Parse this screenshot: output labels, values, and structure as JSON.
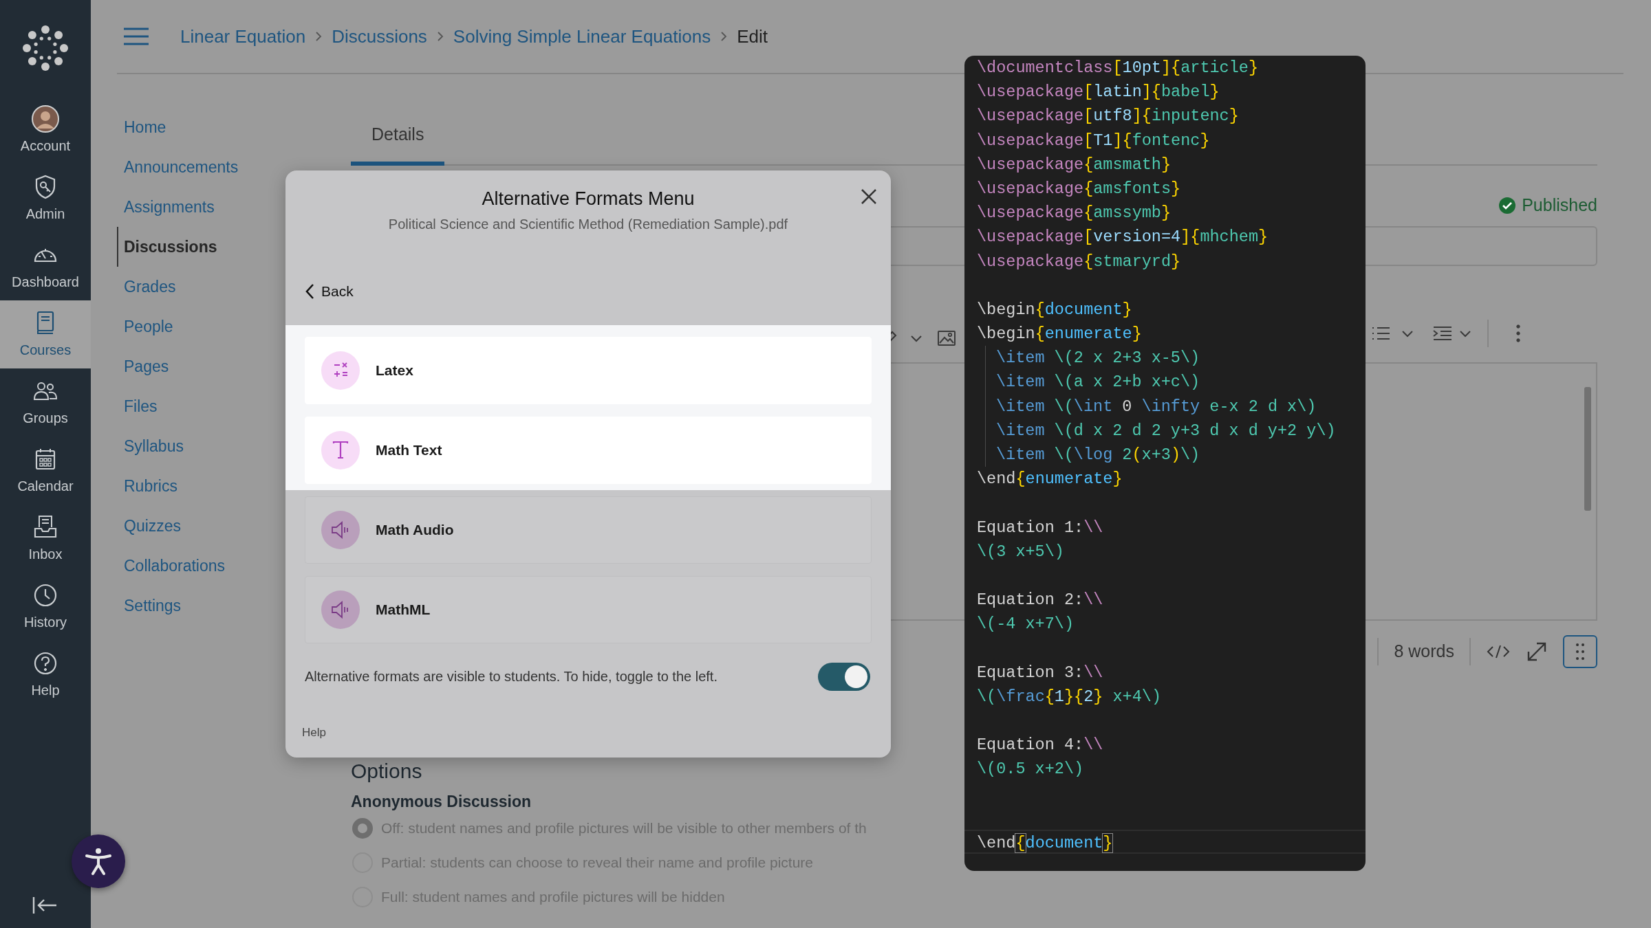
{
  "global_nav": {
    "items": [
      {
        "label": "Account",
        "selected": false
      },
      {
        "label": "Admin",
        "selected": false
      },
      {
        "label": "Dashboard",
        "selected": false
      },
      {
        "label": "Courses",
        "selected": true
      },
      {
        "label": "Groups",
        "selected": false
      },
      {
        "label": "Calendar",
        "selected": false
      },
      {
        "label": "Inbox",
        "selected": false
      },
      {
        "label": "History",
        "selected": false
      },
      {
        "label": "Help",
        "selected": false
      }
    ]
  },
  "breadcrumb": [
    {
      "label": "Linear Equation",
      "current": false
    },
    {
      "label": "Discussions",
      "current": false
    },
    {
      "label": "Solving Simple Linear Equations",
      "current": false
    },
    {
      "label": "Edit",
      "current": true
    }
  ],
  "course_nav": [
    {
      "label": "Home",
      "selected": false
    },
    {
      "label": "Announcements",
      "selected": false
    },
    {
      "label": "Assignments",
      "selected": false
    },
    {
      "label": "Discussions",
      "selected": true
    },
    {
      "label": "Grades",
      "selected": false
    },
    {
      "label": "People",
      "selected": false
    },
    {
      "label": "Pages",
      "selected": false
    },
    {
      "label": "Files",
      "selected": false
    },
    {
      "label": "Syllabus",
      "selected": false
    },
    {
      "label": "Rubrics",
      "selected": false
    },
    {
      "label": "Quizzes",
      "selected": false
    },
    {
      "label": "Collaborations",
      "selected": false
    },
    {
      "label": "Settings",
      "selected": false
    }
  ],
  "tabs": [
    {
      "label": "Details",
      "selected": true
    }
  ],
  "status": {
    "label": "Published"
  },
  "editor": {
    "word_count": "8 words"
  },
  "options": {
    "heading": "Options",
    "anonymous": {
      "title": "Anonymous Discussion",
      "choices": [
        {
          "label": "Off: student names and profile pictures will be visible to other members of th",
          "selected": true
        },
        {
          "label": "Partial: students can choose to reveal their name and profile picture",
          "selected": false
        },
        {
          "label": "Full: student names and profile pictures will be hidden",
          "selected": false
        }
      ]
    }
  },
  "modal": {
    "title": "Alternative Formats Menu",
    "subtitle": "Political Science and Scientific Method (Remediation Sample).pdf",
    "back": "Back",
    "formats": [
      {
        "label": "Latex",
        "highlighted": true
      },
      {
        "label": "Math Text",
        "highlighted": true
      },
      {
        "label": "Math Audio",
        "highlighted": false
      },
      {
        "label": "MathML",
        "highlighted": false
      }
    ],
    "visibility_note": "Alternative formats are visible to students. To hide, toggle to the left.",
    "visible": true,
    "help": "Help"
  },
  "code_editor": {
    "lines": [
      {
        "kind": "code",
        "tokens": [
          {
            "kind": "cmd",
            "text": "\\documentclass"
          },
          {
            "kind": "brace",
            "text": "["
          },
          {
            "kind": "opt",
            "text": "10pt"
          },
          {
            "kind": "brace",
            "text": "]{"
          },
          {
            "kind": "arg",
            "text": "article"
          },
          {
            "kind": "brace",
            "text": "}"
          }
        ]
      },
      {
        "kind": "code",
        "tokens": [
          {
            "kind": "cmd",
            "text": "\\usepackage"
          },
          {
            "kind": "brace",
            "text": "["
          },
          {
            "kind": "opt",
            "text": "latin"
          },
          {
            "kind": "brace",
            "text": "]{"
          },
          {
            "kind": "arg",
            "text": "babel"
          },
          {
            "kind": "brace",
            "text": "}"
          }
        ]
      },
      {
        "kind": "code",
        "tokens": [
          {
            "kind": "cmd",
            "text": "\\usepackage"
          },
          {
            "kind": "brace",
            "text": "["
          },
          {
            "kind": "opt",
            "text": "utf8"
          },
          {
            "kind": "brace",
            "text": "]{"
          },
          {
            "kind": "arg",
            "text": "inputenc"
          },
          {
            "kind": "brace",
            "text": "}"
          }
        ]
      },
      {
        "kind": "code",
        "tokens": [
          {
            "kind": "cmd",
            "text": "\\usepackage"
          },
          {
            "kind": "brace",
            "text": "["
          },
          {
            "kind": "opt",
            "text": "T1"
          },
          {
            "kind": "brace",
            "text": "]{"
          },
          {
            "kind": "arg",
            "text": "fontenc"
          },
          {
            "kind": "brace",
            "text": "}"
          }
        ]
      },
      {
        "kind": "code",
        "tokens": [
          {
            "kind": "cmd",
            "text": "\\usepackage"
          },
          {
            "kind": "brace",
            "text": "{"
          },
          {
            "kind": "arg",
            "text": "amsmath"
          },
          {
            "kind": "brace",
            "text": "}"
          }
        ]
      },
      {
        "kind": "code",
        "tokens": [
          {
            "kind": "cmd",
            "text": "\\usepackage"
          },
          {
            "kind": "brace",
            "text": "{"
          },
          {
            "kind": "arg",
            "text": "amsfonts"
          },
          {
            "kind": "brace",
            "text": "}"
          }
        ]
      },
      {
        "kind": "code",
        "tokens": [
          {
            "kind": "cmd",
            "text": "\\usepackage"
          },
          {
            "kind": "brace",
            "text": "{"
          },
          {
            "kind": "arg",
            "text": "amssymb"
          },
          {
            "kind": "brace",
            "text": "}"
          }
        ]
      },
      {
        "kind": "code",
        "tokens": [
          {
            "kind": "cmd",
            "text": "\\usepackage"
          },
          {
            "kind": "brace",
            "text": "["
          },
          {
            "kind": "opt",
            "text": "version=4"
          },
          {
            "kind": "brace",
            "text": "]{"
          },
          {
            "kind": "arg",
            "text": "mhchem"
          },
          {
            "kind": "brace",
            "text": "}"
          }
        ]
      },
      {
        "kind": "code",
        "tokens": [
          {
            "kind": "cmd",
            "text": "\\usepackage"
          },
          {
            "kind": "brace",
            "text": "{"
          },
          {
            "kind": "arg",
            "text": "stmaryrd"
          },
          {
            "kind": "brace",
            "text": "}"
          }
        ]
      },
      {
        "kind": "blank"
      },
      {
        "kind": "code",
        "tokens": [
          {
            "kind": "plain",
            "text": "\\begin"
          },
          {
            "kind": "brace",
            "text": "{"
          },
          {
            "kind": "env",
            "text": "document"
          },
          {
            "kind": "brace",
            "text": "}"
          }
        ]
      },
      {
        "kind": "code",
        "tokens": [
          {
            "kind": "plain",
            "text": "\\begin"
          },
          {
            "kind": "brace",
            "text": "{"
          },
          {
            "kind": "env",
            "text": "enumerate"
          },
          {
            "kind": "brace",
            "text": "}"
          }
        ]
      },
      {
        "kind": "indented",
        "tokens": [
          {
            "kind": "item",
            "text": "\\item"
          },
          {
            "kind": "math",
            "text": " \\(2 x 2+3 x-5\\)"
          }
        ]
      },
      {
        "kind": "indented",
        "tokens": [
          {
            "kind": "item",
            "text": "\\item"
          },
          {
            "kind": "math",
            "text": " \\(a x 2+b x+c\\)"
          }
        ]
      },
      {
        "kind": "indented",
        "tokens": [
          {
            "kind": "item",
            "text": "\\item"
          },
          {
            "kind": "math",
            "text": " \\("
          },
          {
            "kind": "item",
            "text": "\\int"
          },
          {
            "kind": "plain",
            "text": " 0 "
          },
          {
            "kind": "item",
            "text": "\\infty"
          },
          {
            "kind": "math",
            "text": " e-x 2 d x\\)"
          }
        ]
      },
      {
        "kind": "indented",
        "tokens": [
          {
            "kind": "item",
            "text": "\\item"
          },
          {
            "kind": "math",
            "text": " \\(d x 2 d 2 y+3 d x d y+2 y\\)"
          }
        ]
      },
      {
        "kind": "indented",
        "tokens": [
          {
            "kind": "item",
            "text": "\\item"
          },
          {
            "kind": "math",
            "text": " \\("
          },
          {
            "kind": "item",
            "text": "\\log"
          },
          {
            "kind": "math",
            "text": " 2"
          },
          {
            "kind": "brace",
            "text": "("
          },
          {
            "kind": "math",
            "text": "x+3"
          },
          {
            "kind": "brace",
            "text": ")"
          },
          {
            "kind": "math",
            "text": "\\)"
          }
        ]
      },
      {
        "kind": "code",
        "tokens": [
          {
            "kind": "plain",
            "text": "\\end"
          },
          {
            "kind": "brace",
            "text": "{"
          },
          {
            "kind": "env",
            "text": "enumerate"
          },
          {
            "kind": "brace",
            "text": "}"
          }
        ]
      },
      {
        "kind": "blank"
      },
      {
        "kind": "code",
        "tokens": [
          {
            "kind": "plain",
            "text": "Equation 1:"
          },
          {
            "kind": "cmd",
            "text": "\\\\"
          }
        ]
      },
      {
        "kind": "code",
        "tokens": [
          {
            "kind": "math",
            "text": "\\(3 x+5\\)"
          }
        ]
      },
      {
        "kind": "blank"
      },
      {
        "kind": "code",
        "tokens": [
          {
            "kind": "plain",
            "text": "Equation 2:"
          },
          {
            "kind": "cmd",
            "text": "\\\\"
          }
        ]
      },
      {
        "kind": "code",
        "tokens": [
          {
            "kind": "math",
            "text": "\\(-4 x+7\\)"
          }
        ]
      },
      {
        "kind": "blank"
      },
      {
        "kind": "code",
        "tokens": [
          {
            "kind": "plain",
            "text": "Equation 3:"
          },
          {
            "kind": "cmd",
            "text": "\\\\"
          }
        ]
      },
      {
        "kind": "code",
        "tokens": [
          {
            "kind": "math",
            "text": "\\("
          },
          {
            "kind": "item",
            "text": "\\frac"
          },
          {
            "kind": "brace",
            "text": "{"
          },
          {
            "kind": "opt",
            "text": "1"
          },
          {
            "kind": "brace",
            "text": "}{"
          },
          {
            "kind": "opt",
            "text": "2"
          },
          {
            "kind": "brace",
            "text": "}"
          },
          {
            "kind": "math",
            "text": " x+4\\)"
          }
        ]
      },
      {
        "kind": "blank"
      },
      {
        "kind": "code",
        "tokens": [
          {
            "kind": "plain",
            "text": "Equation 4:"
          },
          {
            "kind": "cmd",
            "text": "\\\\"
          }
        ]
      },
      {
        "kind": "code",
        "tokens": [
          {
            "kind": "math",
            "text": "\\(0.5 x+2\\)"
          }
        ]
      },
      {
        "kind": "blank"
      },
      {
        "kind": "blank"
      },
      {
        "kind": "current",
        "tokens": [
          {
            "kind": "plain",
            "text": "\\end"
          },
          {
            "kind": "brace",
            "text": "{"
          },
          {
            "kind": "env",
            "text": "document"
          },
          {
            "kind": "brace",
            "text": "}"
          }
        ]
      }
    ]
  }
}
